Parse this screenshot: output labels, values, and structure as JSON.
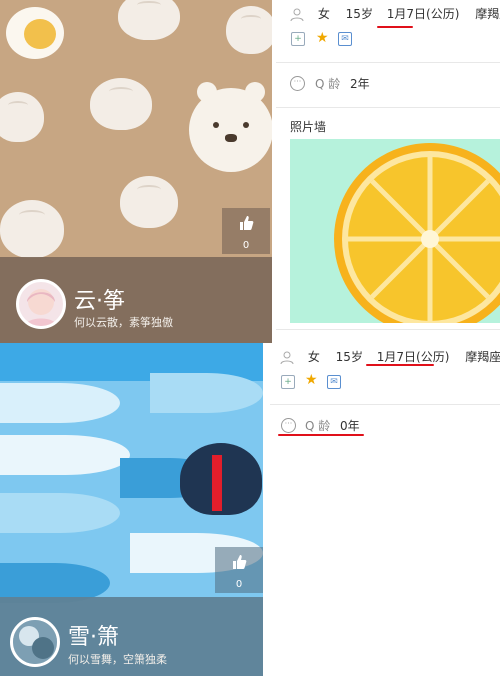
{
  "cards": [
    {
      "name": "云·筝",
      "signature": "何以云散，素筝独傲",
      "likes": "0",
      "bg_color": "#c7a683"
    },
    {
      "name": "雪·箫",
      "signature": "何以雪舞，空箫独柔",
      "likes": "0",
      "bg_color": "#7ec8f0"
    }
  ],
  "profiles": [
    {
      "gender": "女",
      "age": "15岁",
      "birthday": "1月7日(公历)",
      "zodiac": "摩羯座",
      "qage_label": "Q 龄",
      "qage_value": "2年"
    },
    {
      "gender": "女",
      "age": "15岁",
      "birthday": "1月7日(公历)",
      "zodiac": "摩羯座",
      "qage_label": "Q 龄",
      "qage_value": "0年"
    }
  ],
  "photo_wall": {
    "title": "照片墙"
  },
  "colors": {
    "annotation_red": "#e0101a",
    "lemon": "#f7c52c",
    "mint": "#b6f2dc"
  }
}
